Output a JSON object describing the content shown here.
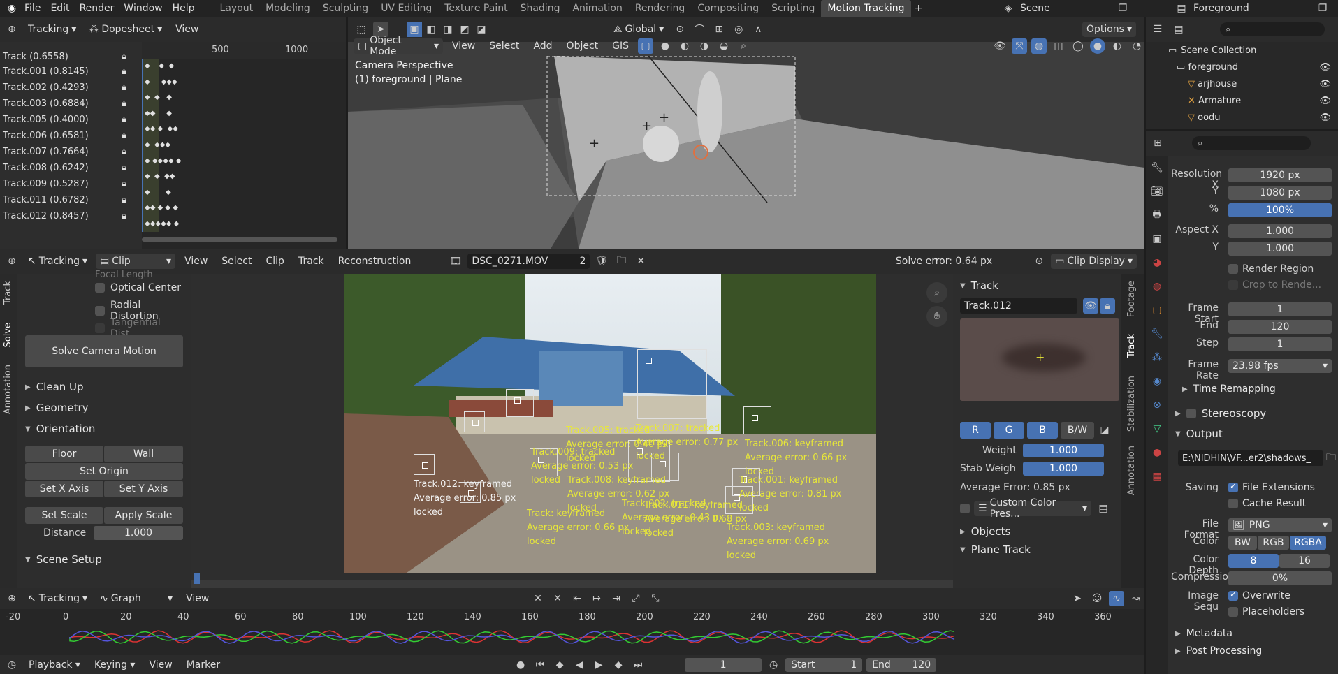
{
  "topbar": {
    "menus": [
      "File",
      "Edit",
      "Render",
      "Window",
      "Help"
    ],
    "workspaces": [
      "Layout",
      "Modeling",
      "Sculpting",
      "UV Editing",
      "Texture Paint",
      "Shading",
      "Animation",
      "Rendering",
      "Compositing",
      "Scripting",
      "Motion Tracking"
    ],
    "active": "Motion Tracking",
    "scene": "Scene",
    "view_layer": "Foreground"
  },
  "dopesheet": {
    "mode": "Tracking",
    "editor": "Dopesheet",
    "view": "View",
    "frames": [
      "500",
      "1000"
    ],
    "tracks": [
      "Track (0.6558)",
      "Track.001 (0.8145)",
      "Track.002 (0.4293)",
      "Track.003 (0.6884)",
      "Track.005 (0.4000)",
      "Track.006 (0.6581)",
      "Track.007 (0.7664)",
      "Track.008 (0.6242)",
      "Track.009 (0.5287)",
      "Track.011 (0.6782)",
      "Track.012 (0.8457)"
    ]
  },
  "viewport": {
    "orientation": "Global",
    "options": "Options",
    "mode": "Object Mode",
    "menus": [
      "View",
      "Select",
      "Add",
      "Object",
      "GIS"
    ],
    "overlay1": "Camera Perspective",
    "overlay2": "(1) foreground | Plane"
  },
  "outliner": {
    "collection": "Scene Collection",
    "items": [
      "foreground",
      "arjhouse",
      "Armature",
      "oodu"
    ]
  },
  "clip": {
    "mode": "Tracking",
    "editor": "Clip",
    "menus": [
      "View",
      "Select",
      "Clip",
      "Track",
      "Reconstruction"
    ],
    "file": "DSC_0271.MOV",
    "users": "2",
    "solve_error": "Solve error: 0.64 px",
    "display": "Clip Display"
  },
  "solve": {
    "refine_cut": "Focal Length",
    "options": [
      "Optical Center",
      "Radial Distortion",
      "Tangential Dist..."
    ],
    "solve_btn": "Solve Camera Motion",
    "clean": "Clean Up",
    "geometry": "Geometry",
    "orientation": "Orientation",
    "floor": "Floor",
    "wall": "Wall",
    "set_origin": "Set Origin",
    "set_x": "Set X Axis",
    "set_y": "Set Y Axis",
    "set_scale": "Set Scale",
    "apply_scale": "Apply Scale",
    "distance_label": "Distance",
    "distance": "1.000",
    "scene_setup": "Scene Setup",
    "tabs": [
      "Track",
      "Solve",
      "Annotation"
    ]
  },
  "annotations": [
    {
      "name": "track-012",
      "lines": [
        "Track.012: keyframed",
        "Average error: 0.85 px",
        "locked"
      ],
      "white": true
    },
    {
      "name": "track-005",
      "lines": [
        "Track.005: tracked",
        "Average error: 0.40 px",
        "locked"
      ]
    },
    {
      "name": "track-007",
      "lines": [
        "Track.007: tracked",
        "Average error: 0.77 px",
        "locked"
      ]
    },
    {
      "name": "track-009",
      "lines": [
        "Track.009: tracked",
        "Average error: 0.53 px",
        "locked"
      ]
    },
    {
      "name": "track-006",
      "lines": [
        "Track.006: keyframed",
        "Average error: 0.66 px",
        "locked"
      ]
    },
    {
      "name": "track-008",
      "lines": [
        "Track.008: keyframed",
        "Average error: 0.62 px",
        "locked"
      ]
    },
    {
      "name": "track-001",
      "lines": [
        "Track.001: keyframed",
        "Average error: 0.81 px",
        "locked"
      ]
    },
    {
      "name": "track-002",
      "lines": [
        "Track.002: tracked",
        "Average error: 0.43 px",
        "locked"
      ]
    },
    {
      "name": "track-011",
      "lines": [
        "Track.011: keyframed",
        "Average error: 0.68 px",
        "locked"
      ]
    },
    {
      "name": "track",
      "lines": [
        "Track: keyframed",
        "Average error: 0.66 px",
        "locked"
      ]
    },
    {
      "name": "track-003",
      "lines": [
        "Track.003: keyframed",
        "Average error: 0.69 px",
        "locked"
      ]
    }
  ],
  "trackpanel": {
    "title": "Track",
    "name": "Track.012",
    "channels": [
      "R",
      "G",
      "B",
      "B/W"
    ],
    "weight_label": "Weight",
    "weight": "1.000",
    "stab_label": "Stab Weigh",
    "stab": "1.000",
    "avg": "Average Error: 0.85 px",
    "preset": "Custom Color Pres...",
    "objects": "Objects",
    "plane": "Plane Track",
    "tabs": [
      "Footage",
      "Track",
      "Stabilization",
      "Annotation"
    ]
  },
  "graph": {
    "mode": "Tracking",
    "editor": "Graph",
    "view": "View",
    "ticks": [
      "-20",
      "0",
      "20",
      "40",
      "60",
      "80",
      "100",
      "120",
      "140",
      "160",
      "180",
      "200",
      "220",
      "240",
      "260",
      "280",
      "300",
      "320",
      "340",
      "360"
    ]
  },
  "timeline": {
    "menus": [
      "Playback",
      "Keying",
      "View",
      "Marker"
    ],
    "frame": "1",
    "start_label": "Start",
    "start": "1",
    "end_label": "End",
    "end": "120"
  },
  "props": {
    "res_x_label": "Resolution X",
    "res_x": "1920 px",
    "res_y_label": "Y",
    "res_y": "1080 px",
    "pct_label": "%",
    "pct": "100%",
    "aspect_x_label": "Aspect X",
    "aspect_x": "1.000",
    "aspect_y_label": "Y",
    "aspect_y": "1.000",
    "render_region": "Render Region",
    "crop": "Crop to Rende...",
    "fs_label": "Frame Start",
    "fs": "1",
    "end_label": "End",
    "end": "120",
    "step_label": "Step",
    "step": "1",
    "fr_label": "Frame Rate",
    "fr": "23.98 fps",
    "time_remap": "Time Remapping",
    "stereo": "Stereoscopy",
    "output": "Output",
    "path": "E:\\NIDHIN\\VF...er2\\shadows_",
    "saving": "Saving",
    "file_ext": "File Extensions",
    "cache": "Cache Result",
    "ff_label": "File Format",
    "ff": "PNG",
    "color_label": "Color",
    "colors": [
      "BW",
      "RGB",
      "RGBA"
    ],
    "depth_label": "Color Depth",
    "depths": [
      "8",
      "16"
    ],
    "comp_label": "Compression",
    "comp": "0%",
    "imgseq_label": "Image Sequ",
    "overwrite": "Overwrite",
    "placeholders": "Placeholders",
    "metadata": "Metadata",
    "post": "Post Processing"
  }
}
